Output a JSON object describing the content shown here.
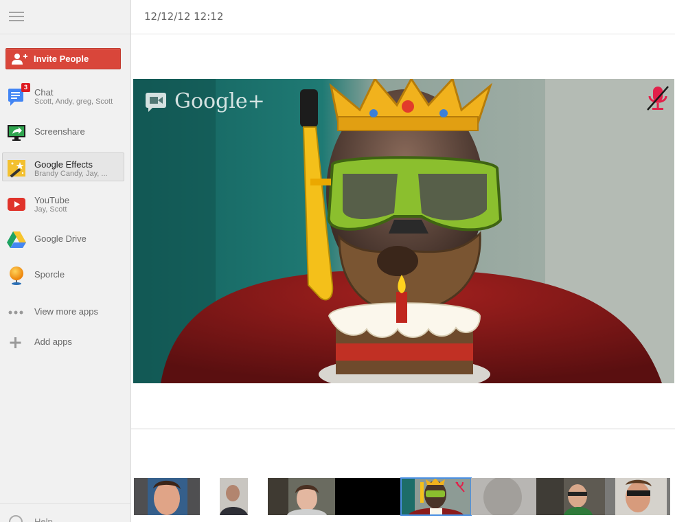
{
  "header": {
    "timestamp": "12/12/12 12:12"
  },
  "sidebar": {
    "menu_icon": "hamburger-menu-icon",
    "invite": {
      "label": "Invite People",
      "icon": "add-person-icon",
      "color": "#d9463a"
    },
    "apps": [
      {
        "name": "Chat",
        "sub": "Scott, Andy, greg, Scott",
        "badge": "3",
        "icon": "chat-icon"
      },
      {
        "name": "Screenshare",
        "sub": "",
        "icon": "screenshare-icon"
      },
      {
        "name": "Google Effects",
        "sub": "Brandy Candy, Jay, ...",
        "icon": "effects-wand-icon",
        "selected": true
      },
      {
        "name": "YouTube",
        "sub": "Jay, Scott",
        "icon": "youtube-icon"
      },
      {
        "name": "Google Drive",
        "sub": "",
        "icon": "drive-icon"
      },
      {
        "name": "Sporcle",
        "sub": "",
        "icon": "sporcle-icon"
      },
      {
        "name": "View more apps",
        "sub": "",
        "icon": "more-dots-icon"
      },
      {
        "name": "Add apps",
        "sub": "",
        "icon": "plus-icon"
      }
    ],
    "help": {
      "label": "Help",
      "icon": "help-circle-icon"
    }
  },
  "video": {
    "watermark": "Google+",
    "mute_icon": "microphone-muted-icon",
    "accent": "#e2204a"
  },
  "filmstrip": {
    "participants": [
      {
        "name": "participant-1"
      },
      {
        "name": "participant-2"
      },
      {
        "name": "participant-3"
      },
      {
        "name": "participant-4-active",
        "active": true
      },
      {
        "name": "participant-5"
      },
      {
        "name": "participant-6"
      },
      {
        "name": "participant-7"
      }
    ]
  }
}
